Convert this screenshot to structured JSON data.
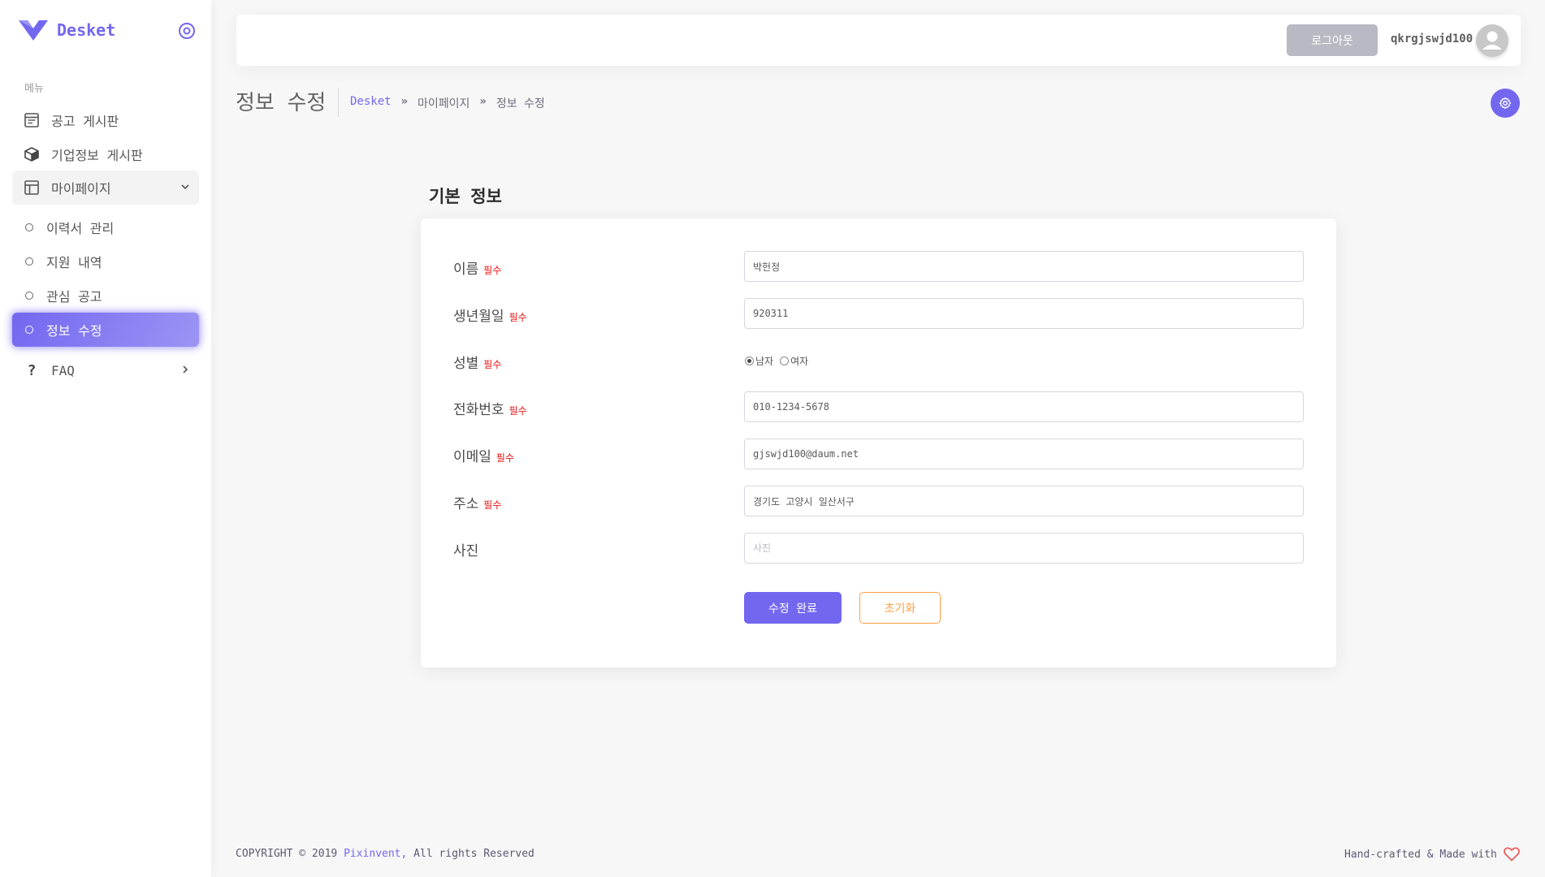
{
  "brand": {
    "name": "Desket"
  },
  "sidebar": {
    "menu_header": "메뉴",
    "items": [
      {
        "label": "공고 게시판",
        "icon": "calendar-icon"
      },
      {
        "label": "기업정보 게시판",
        "icon": "box-icon"
      },
      {
        "label": "마이페이지",
        "icon": "layout-icon"
      }
    ],
    "sub_items": [
      {
        "label": "이력서 관리"
      },
      {
        "label": "지원 내역"
      },
      {
        "label": "관심 공고"
      },
      {
        "label": "정보 수정"
      }
    ],
    "faq": {
      "label": "FAQ",
      "icon_text": "?"
    }
  },
  "navbar": {
    "logout_label": "로그아웃",
    "username": "qkrgjswjd100"
  },
  "page": {
    "title": "정보 수정",
    "breadcrumb": [
      "Desket",
      "마이페이지",
      "정보 수정"
    ],
    "breadcrumb_sep": "»"
  },
  "form": {
    "section_title": "기본 정보",
    "required_text": "필수",
    "fields": {
      "name": {
        "label": "이름",
        "value": "박헌정"
      },
      "birth": {
        "label": "생년월일",
        "value": "920311"
      },
      "gender": {
        "label": "성별",
        "options": [
          "남자",
          "여자"
        ],
        "selected": "남자"
      },
      "phone": {
        "label": "전화번호",
        "value": "010-1234-5678"
      },
      "email": {
        "label": "이메일",
        "value": "gjswjd100@daum.net"
      },
      "address": {
        "label": "주소",
        "value": "경기도 고양시 일산서구"
      },
      "photo": {
        "label": "사진",
        "placeholder": "사진"
      }
    },
    "submit_label": "수정 완료",
    "reset_label": "초기화"
  },
  "footer": {
    "copyright": "COPYRIGHT © 2019 ",
    "company": "Pixinvent,",
    "rights": " All rights Reserved",
    "made_with": "Hand-crafted & Made with"
  },
  "colors": {
    "primary": "#7367f0",
    "warning": "#ff9f43",
    "danger": "#ea1010"
  }
}
